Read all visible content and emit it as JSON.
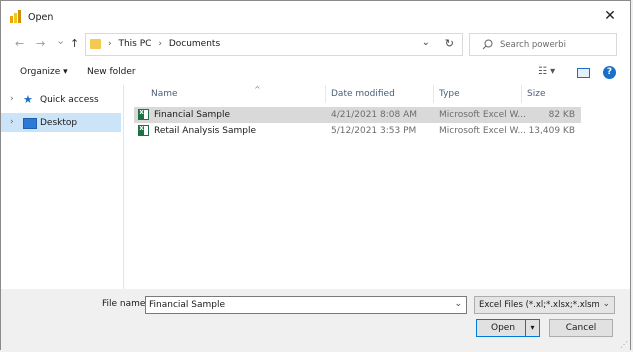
{
  "window": {
    "title": "Open",
    "close_glyph": "✕"
  },
  "nav": {
    "back_glyph": "←",
    "forward_glyph": "→",
    "recent_glyph": "⌄",
    "up_glyph": "↑",
    "breadcrumbs": [
      "This PC",
      "Documents"
    ],
    "breadcrumb_sep": "›",
    "dropdown_glyph": "⌄",
    "refresh_glyph": "↻",
    "search_placeholder": "Search powerbi"
  },
  "toolbar": {
    "organize_label": "Organize ▾",
    "new_folder_label": "New folder",
    "view_glyph": "☷ ▾",
    "help_glyph": "?"
  },
  "sidebar": {
    "items": [
      {
        "label": "Quick access",
        "icon": "star-icon",
        "glyph": "★",
        "chevron": "›"
      },
      {
        "label": "Desktop",
        "icon": "desktop-icon",
        "chevron": "›",
        "selected": true
      }
    ]
  },
  "files": {
    "columns": {
      "name": "Name",
      "date": "Date modified",
      "type": "Type",
      "size": "Size"
    },
    "sort_caret": "^",
    "rows": [
      {
        "name": "Financial Sample",
        "date": "4/21/2021 8:08 AM",
        "type": "Microsoft Excel W...",
        "size": "82 KB",
        "selected": true
      },
      {
        "name": "Retail Analysis Sample",
        "date": "5/12/2021 3:53 PM",
        "type": "Microsoft Excel W...",
        "size": "13,409 KB",
        "selected": false
      }
    ]
  },
  "footer": {
    "file_name_label": "File name:",
    "file_name_value": "Financial Sample",
    "dropdown_glyph": "⌄",
    "file_type_value": "Excel Files (*.xl;*.xlsx;*.xlsm;*.xl",
    "open_label": "Open",
    "open_split_glyph": "▾",
    "cancel_label": "Cancel"
  },
  "colors": {
    "accent": "#0078d7",
    "selected_nav": "#cce4f7",
    "selected_row": "#d9d9d9",
    "excel_green": "#1e7145",
    "folder": "#f3c94f"
  }
}
